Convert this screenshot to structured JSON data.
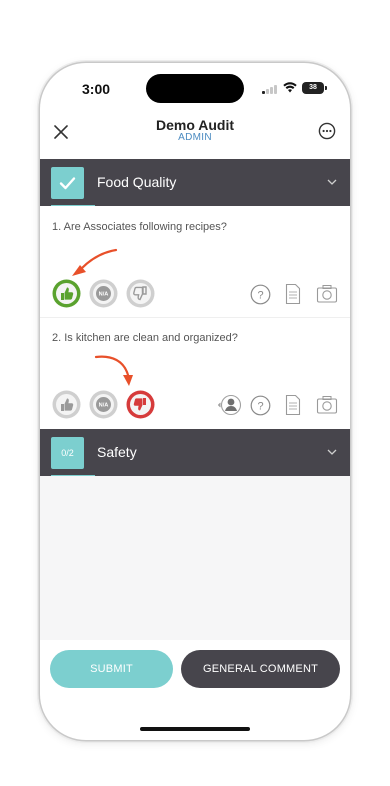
{
  "status": {
    "time": "3:00",
    "battery": "38"
  },
  "header": {
    "title": "Demo Audit",
    "subtitle": "ADMIN"
  },
  "sections": [
    {
      "badge": "",
      "title": "Food Quality",
      "state": "complete"
    },
    {
      "badge": "0/2",
      "title": "Safety",
      "state": "collapsed"
    }
  ],
  "questions": [
    {
      "text": "1. Are Associates following recipes?",
      "selected": "thumbs-up"
    },
    {
      "text": "2. Is kitchen are clean and organized?",
      "selected": "thumbs-down"
    }
  ],
  "answers": {
    "na_label": "N/A"
  },
  "actions": {
    "submit": "SUBMIT",
    "general_comment": "GENERAL COMMENT"
  },
  "colors": {
    "accent": "#7ccfcf",
    "header_bg": "#47454c",
    "positive": "#5aa22e",
    "negative": "#d63b3b",
    "arrow": "#e8502a",
    "subtitle": "#4a8ac0"
  }
}
